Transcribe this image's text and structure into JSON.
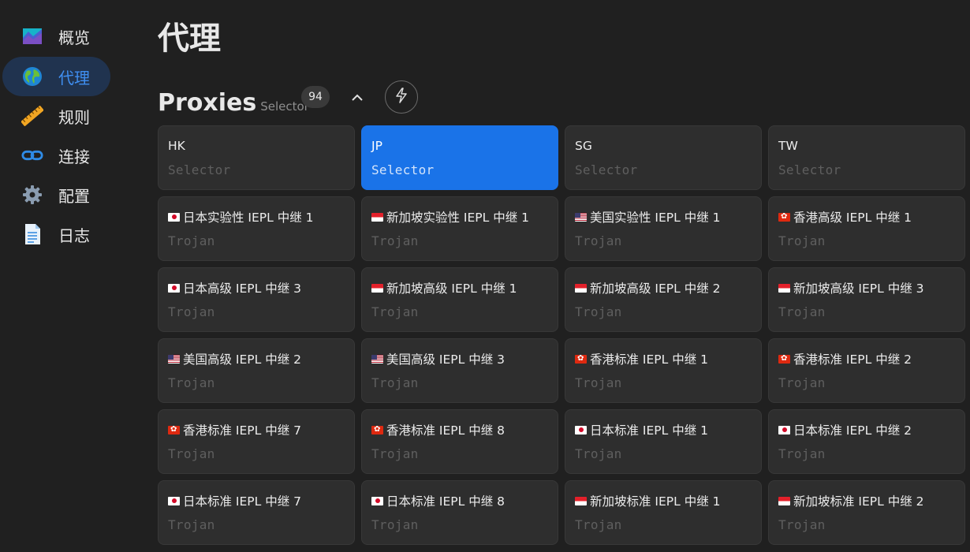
{
  "sidebar": {
    "items": [
      {
        "label": "概览",
        "icon": "chart-icon"
      },
      {
        "label": "代理",
        "icon": "globe-icon",
        "active": true
      },
      {
        "label": "规则",
        "icon": "ruler-icon"
      },
      {
        "label": "连接",
        "icon": "link-icon"
      },
      {
        "label": "配置",
        "icon": "gear-icon"
      },
      {
        "label": "日志",
        "icon": "document-icon"
      }
    ]
  },
  "page": {
    "title": "代理"
  },
  "group": {
    "name": "Proxies",
    "type": "Selector",
    "count": "94",
    "collapse_icon": "chevron-up-icon",
    "test_icon": "lightning-icon"
  },
  "proxies": [
    {
      "name": "HK",
      "type": "Selector",
      "flag": ""
    },
    {
      "name": "JP",
      "type": "Selector",
      "flag": "",
      "selected": true
    },
    {
      "name": "SG",
      "type": "Selector",
      "flag": ""
    },
    {
      "name": "TW",
      "type": "Selector",
      "flag": ""
    },
    {
      "name": "日本实验性 IEPL 中继 1",
      "type": "Trojan",
      "flag": "jp"
    },
    {
      "name": "新加坡实验性 IEPL 中继 1",
      "type": "Trojan",
      "flag": "sg"
    },
    {
      "name": "美国实验性 IEPL 中继 1",
      "type": "Trojan",
      "flag": "us"
    },
    {
      "name": "香港高级 IEPL 中继 1",
      "type": "Trojan",
      "flag": "hk"
    },
    {
      "name": "日本高级 IEPL 中继 3",
      "type": "Trojan",
      "flag": "jp"
    },
    {
      "name": "新加坡高级 IEPL 中继 1",
      "type": "Trojan",
      "flag": "sg"
    },
    {
      "name": "新加坡高级 IEPL 中继 2",
      "type": "Trojan",
      "flag": "sg"
    },
    {
      "name": "新加坡高级 IEPL 中继 3",
      "type": "Trojan",
      "flag": "sg"
    },
    {
      "name": "美国高级 IEPL 中继 2",
      "type": "Trojan",
      "flag": "us"
    },
    {
      "name": "美国高级 IEPL 中继 3",
      "type": "Trojan",
      "flag": "us"
    },
    {
      "name": "香港标准 IEPL 中继 1",
      "type": "Trojan",
      "flag": "hk"
    },
    {
      "name": "香港标准 IEPL 中继 2",
      "type": "Trojan",
      "flag": "hk"
    },
    {
      "name": "香港标准 IEPL 中继 7",
      "type": "Trojan",
      "flag": "hk"
    },
    {
      "name": "香港标准 IEPL 中继 8",
      "type": "Trojan",
      "flag": "hk"
    },
    {
      "name": "日本标准 IEPL 中继 1",
      "type": "Trojan",
      "flag": "jp"
    },
    {
      "name": "日本标准 IEPL 中继 2",
      "type": "Trojan",
      "flag": "jp"
    },
    {
      "name": "日本标准 IEPL 中继 7",
      "type": "Trojan",
      "flag": "jp"
    },
    {
      "name": "日本标准 IEPL 中继 8",
      "type": "Trojan",
      "flag": "jp"
    },
    {
      "name": "新加坡标准 IEPL 中继 1",
      "type": "Trojan",
      "flag": "sg"
    },
    {
      "name": "新加坡标准 IEPL 中继 2",
      "type": "Trojan",
      "flag": "sg"
    }
  ],
  "colors": {
    "background": "#202020",
    "card": "#2e2e2e",
    "selected": "#1a73e8",
    "active_nav": "#20334f",
    "accent_text": "#3f8ef0"
  }
}
